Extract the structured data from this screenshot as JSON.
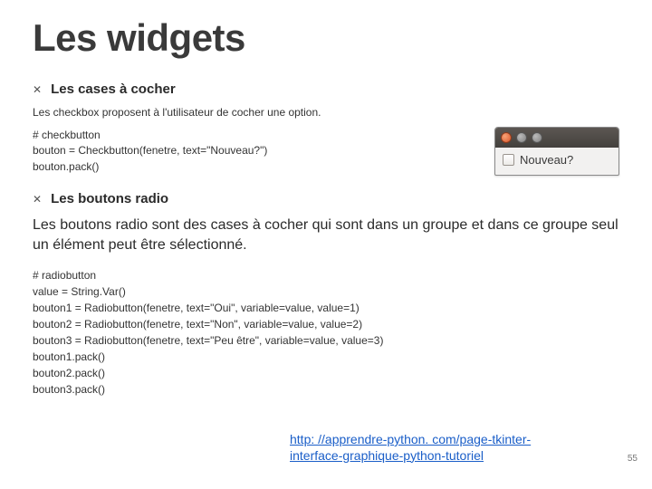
{
  "title": "Les widgets",
  "section1": {
    "heading": "Les cases à cocher",
    "desc": "Les checkbox proposent à l'utilisateur de cocher une option.",
    "code": "# checkbutton\nbouton = Checkbutton(fenetre, text=\"Nouveau?\")\nbouton.pack()"
  },
  "section2": {
    "heading": "Les boutons radio",
    "desc": "Les boutons radio sont des cases à cocher qui sont dans un groupe et dans ce groupe seul un élément peut être sélectionné.",
    "code": "# radiobutton\nvalue = String.Var()\nbouton1 = Radiobutton(fenetre, text=\"Oui\", variable=value, value=1)\nbouton2 = Radiobutton(fenetre, text=\"Non\", variable=value, value=2)\nbouton3 = Radiobutton(fenetre, text=\"Peu être\", variable=value, value=3)\nbouton1.pack()\nbouton2.pack()\nbouton3.pack()"
  },
  "demo": {
    "checkbox_label": "Nouveau?"
  },
  "link": "http: //apprendre-python. com/page-tkinter-interface-graphique-python-tutoriel",
  "pagenum": "55"
}
